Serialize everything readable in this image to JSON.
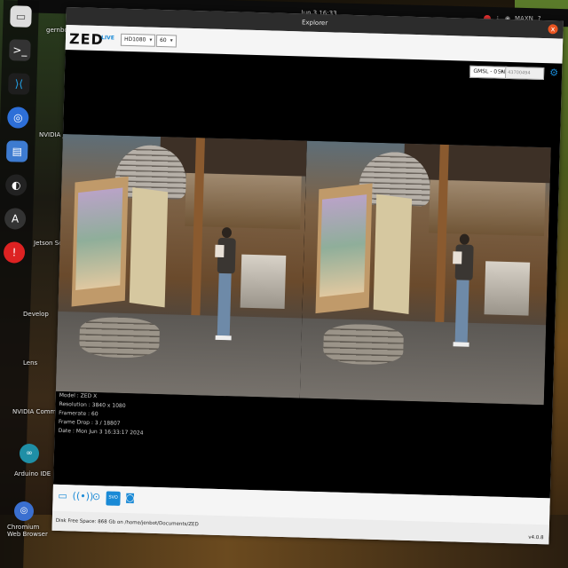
{
  "top_bar": {
    "clock": "Jun 3  16:33",
    "user": "MAXN"
  },
  "dock": {
    "items": [
      "files",
      "terminal",
      "vscode",
      "chromium",
      "notes",
      "obs",
      "app-store",
      "help"
    ]
  },
  "desktop": {
    "labels": [
      "gernbot",
      "NVIDIA Jetson",
      "Jetson Sc Forum",
      "Develop",
      "Lens",
      "NVIDIA Commu",
      "Arduino IDE",
      "Chromium Web Browser"
    ]
  },
  "window": {
    "title": "Explorer",
    "close_label": "x",
    "logo": "ZED",
    "live_label": "LIVE",
    "resolution_select": "HD1080",
    "fps_select": "60",
    "id_label": "ID",
    "id_select": "GMSL - 0",
    "sn_label": "SN",
    "sn_value": "43700494"
  },
  "camera": {
    "model_line": "Model : ZED X",
    "resolution_line": "Resolution : 3840 x 1080",
    "framerate_line": "Framerate : 60",
    "framedrop_line": "Frame Drop : 3 / 18807",
    "date_line": "Date : Mon Jun 3 16:33:17 2024"
  },
  "statusbar": {
    "disk_text": "Disk Free Space: 868 Gb  on /home/jenbot/Documents/ZED",
    "version": "v4.0.8"
  },
  "colors": {
    "accent": "#1a8ad6",
    "titlebar": "#2c2c2c",
    "close": "#e95420"
  }
}
